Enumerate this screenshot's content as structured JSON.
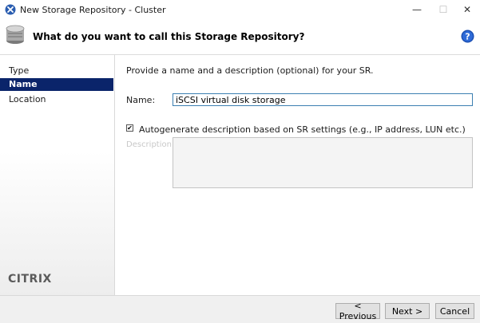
{
  "window": {
    "title": "New Storage Repository - Cluster",
    "minimize_glyph": "—",
    "maximize_glyph": "☐",
    "close_glyph": "✕"
  },
  "header": {
    "title": "What do you want to call this Storage Repository?",
    "help_icon": "help-icon"
  },
  "sidebar": {
    "items": [
      {
        "label": "Type",
        "selected": false
      },
      {
        "label": "Name",
        "selected": true
      },
      {
        "label": "Location",
        "selected": false
      }
    ],
    "logo": "CITRIX"
  },
  "main": {
    "intro": "Provide a name and a description (optional) for your SR.",
    "name_label": "Name:",
    "name_value": "iSCSI virtual disk storage",
    "autogen_checked": true,
    "autogen_check_glyph": "✔",
    "autogen_label": "Autogenerate description based on SR settings (e.g., IP address, LUN etc.)",
    "description_label": "Description:",
    "description_value": ""
  },
  "footer": {
    "previous_label": "< Previous",
    "next_label": "Next >",
    "cancel_label": "Cancel"
  },
  "colors": {
    "selection": "#0a246a",
    "help_blue": "#1b4fb3",
    "input_border": "#3c7fb1"
  }
}
